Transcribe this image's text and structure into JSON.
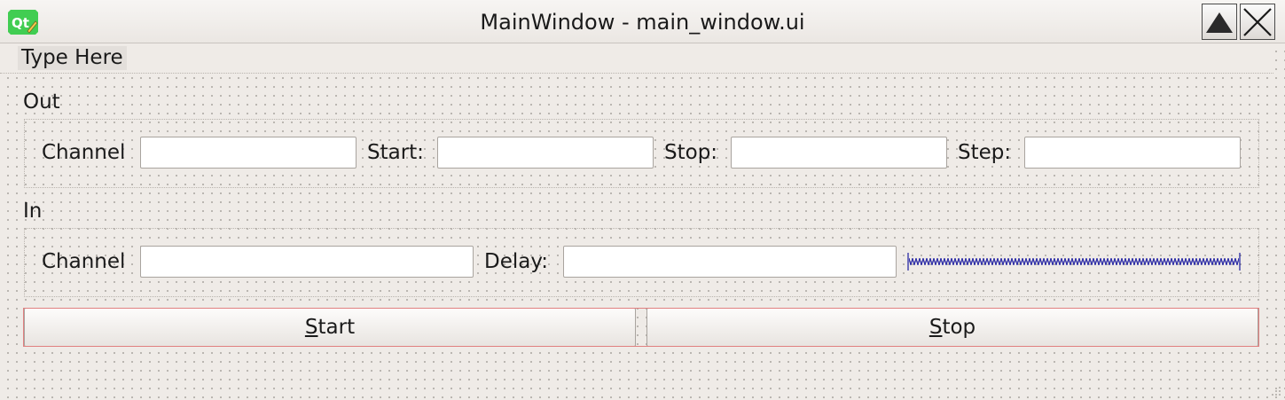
{
  "window": {
    "title": "MainWindow - main_window.ui",
    "logo_text": "Qt",
    "shade_icon": "shade-up-triangle-icon",
    "close_icon": "close-x-icon"
  },
  "menubar": {
    "placeholder": "Type Here"
  },
  "out_group": {
    "label": "Out",
    "channel_label": "Channel",
    "start_label": "Start:",
    "stop_label": "Stop:",
    "step_label": "Step:",
    "channel_value": "",
    "start_value": "",
    "stop_value": "",
    "step_value": ""
  },
  "in_group": {
    "label": "In",
    "channel_label": "Channel",
    "delay_label": "Delay:",
    "channel_value": "",
    "delay_value": ""
  },
  "buttons": {
    "start_accel": "S",
    "start_rest": "tart",
    "stop_accel": "S",
    "stop_rest": "top"
  },
  "colors": {
    "background": "#efebe7",
    "layout_frame": "#e08080",
    "spacer": "#1a1aa0"
  }
}
